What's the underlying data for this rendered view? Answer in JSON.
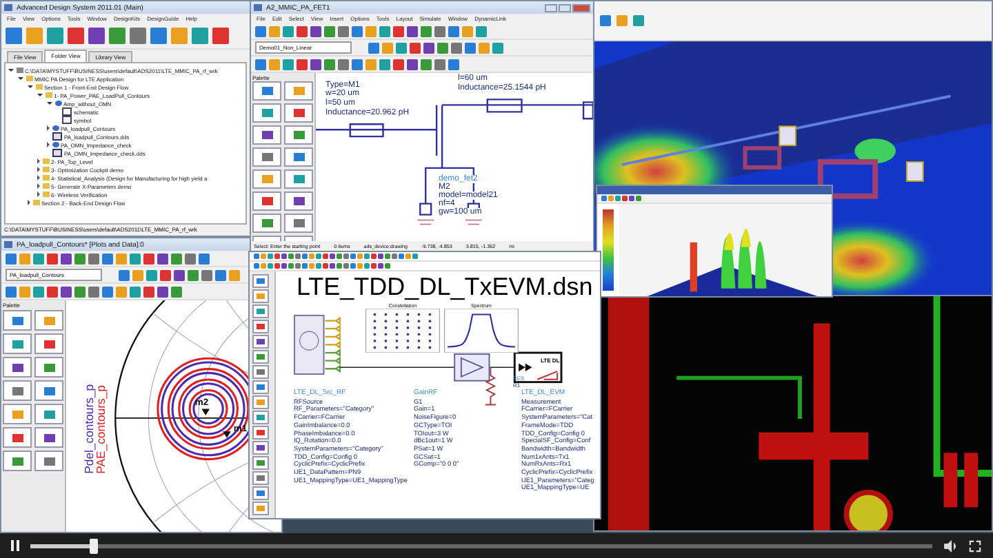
{
  "main_window": {
    "title": "Advanced Design System 2011.01 (Main)",
    "menu": [
      "File",
      "View",
      "Options",
      "Tools",
      "Window",
      "DesignKits",
      "DesignGuide",
      "Help"
    ],
    "tabs": [
      {
        "label": "File View",
        "selected": false
      },
      {
        "label": "Folder View",
        "selected": true
      },
      {
        "label": "Library View",
        "selected": false
      }
    ],
    "tree": [
      {
        "label": "C:\\DATA\\MYSTUFF\\BUSINESS\\users\\default\\ADS2011\\LTE_MMIC_PA_rf_wrk",
        "kind": "root",
        "expanded": true,
        "children": [
          {
            "label": "MMIC PA Design for LTE Application",
            "kind": "folder",
            "expanded": true,
            "children": [
              {
                "label": "Section 1 - Front-End Design Flow",
                "kind": "folder",
                "expanded": true,
                "children": [
                  {
                    "label": "1- PA_Power_PAE_LoadPull_Contours",
                    "kind": "folder",
                    "expanded": true,
                    "children": [
                      {
                        "label": "Amp_without_OMN",
                        "kind": "cell",
                        "expanded": true,
                        "children": [
                          {
                            "label": "schematic",
                            "kind": "view"
                          },
                          {
                            "label": "symbol",
                            "kind": "view"
                          }
                        ]
                      },
                      {
                        "label": "PA_loadpull_Contours",
                        "kind": "cell",
                        "expanded": false
                      },
                      {
                        "label": "PA_loadpull_Contours.dds",
                        "kind": "dds"
                      },
                      {
                        "label": "PA_OMN_Impedance_check",
                        "kind": "cell",
                        "expanded": false
                      },
                      {
                        "label": "PA_OMN_Impedance_check.dds",
                        "kind": "dds"
                      }
                    ]
                  },
                  {
                    "label": "2- PA_Top_Level",
                    "kind": "folder",
                    "expanded": false
                  },
                  {
                    "label": "3- Optimization Cockpit demo",
                    "kind": "folder",
                    "expanded": false
                  },
                  {
                    "label": "4- Statistical_Analysis (Design for Manufacturing for high yield a",
                    "kind": "folder",
                    "expanded": false
                  },
                  {
                    "label": "5- Generate X-Parameters demo",
                    "kind": "folder",
                    "expanded": false
                  },
                  {
                    "label": "6- Wireless Verification",
                    "kind": "folder",
                    "expanded": false
                  }
                ]
              },
              {
                "label": "Section 2 - Back-End Design Flow",
                "kind": "folder",
                "expanded": false
              }
            ]
          }
        ]
      }
    ],
    "path": "C:\\DATA\\MYSTUFF\\BUSINESS\\users\\default\\ADS2011\\LTE_MMIC_PA_rf_wrk"
  },
  "layout_window": {
    "title": "A2_MMIC_PA_FET1",
    "menu": [
      "File",
      "Edit",
      "Select",
      "View",
      "Insert",
      "Options",
      "Tools",
      "Layout",
      "Simulate",
      "Window",
      "DynamicLink"
    ],
    "dropdown": "Demo01_Non_Linear",
    "palette_title": "Palette",
    "annotations": [
      {
        "text": "Type=M1",
        "kind": "param"
      },
      {
        "text": "w=20 um",
        "kind": "param"
      },
      {
        "text": "l=50 um",
        "kind": "param"
      },
      {
        "text": "Inductance=20.962 pH",
        "kind": "param"
      },
      {
        "text": "l=60 um",
        "kind": "param"
      },
      {
        "text": "Inductance=25.1544 pH",
        "kind": "param"
      },
      {
        "text": "demo_fet2",
        "kind": "name"
      },
      {
        "text": "M2",
        "kind": "param"
      },
      {
        "text": "model=model21",
        "kind": "param"
      },
      {
        "text": "nf=4",
        "kind": "param"
      },
      {
        "text": "gw=100 um",
        "kind": "param"
      }
    ],
    "status": [
      "Select: Enter the starting point",
      "0 items",
      "ads_device:drawing",
      "-9.738, -4.853",
      "3.815, -1.362",
      "mi"
    ]
  },
  "plot_window": {
    "title": "PA_loadpull_Contours* [Plots and Data]:0",
    "dropdown": "PA_loadpull_Contours",
    "palette_title": "Palette",
    "traces": [
      {
        "label": "Pdel_contours_p",
        "color": "#4b2ab0"
      },
      {
        "label": "PAE_contours_p",
        "color": "#e02020"
      }
    ],
    "markers": [
      "m2",
      "m1"
    ]
  },
  "schematic_window": {
    "title": "LTE_TDD_DL_TxEVM.dsn",
    "charts": [
      "Constellation",
      "Spectrum"
    ],
    "blocks": [
      {
        "name": "LTE_DL_Src_RF",
        "params": [
          "RFSource",
          "RF_Parameters=\"Category\"",
          "FCarrier=FCarrier",
          "GainImbalance=0.0",
          "PhaseImbalance=0.0",
          "IQ_Rotation=0.0",
          "SystemParameters=\"Category\"",
          "TDD_Config=Config 0",
          "CyclicPrefix=CyclicPrefix",
          "UE1_DataPattern=PN9",
          "UE1_MappingType=UE1_MappingType"
        ]
      },
      {
        "name": "GainRF",
        "params": [
          "G1",
          "Gain=1",
          "NoiseFigure=0",
          "GCType=TOI",
          "TOIout=3 W",
          "dBc1out=1 W",
          "PSat=1 W",
          "GCSat=1",
          "GComp=\"0 0 0\""
        ]
      },
      {
        "name": "LTE_DL_EVM",
        "params": [
          "Measurement",
          "FCarrier=FCarrier",
          "SystemParameters=\"Cat",
          "FrameMode=TDD",
          "TDD_Config=Config 0",
          "SpecialSF_Config=Conf",
          "Bandwidth=Bandwidth",
          "Num1xAnts=Tx1",
          "NumRxAnts=Rx1",
          "CyclicPrefix=CyclicPrefix",
          "UE1_Parameters=\"Categ",
          "UE1_MappingType=UE"
        ]
      }
    ],
    "resistor": [
      "RES",
      "R1"
    ],
    "evm_block_label": "LTE DL"
  },
  "player": {
    "playing": true,
    "level": 0.07
  }
}
